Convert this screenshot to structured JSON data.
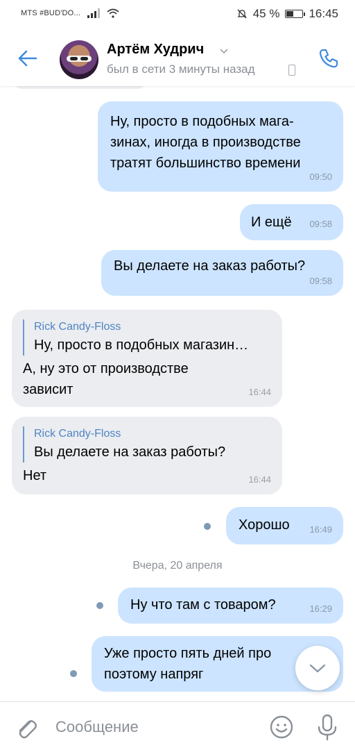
{
  "statusbar": {
    "carrier": "MTS #BUD'DO...",
    "battery": "45 %",
    "battery_level": 0.45,
    "time": "16:45"
  },
  "header": {
    "name": "Артём Худрич",
    "status": "был в сети 3 минуты назад"
  },
  "messages": [
    {
      "dir": "out",
      "lines": [
        "Ну, просто в подобных мага-",
        "зинах, иногда в производстве",
        "тратят большинство времени"
      ],
      "time": "09:50"
    },
    {
      "dir": "out",
      "lines": [
        "И ещё"
      ],
      "time": "09:58"
    },
    {
      "dir": "out",
      "lines": [
        "Вы делаете на заказ работы?"
      ],
      "time": "09:58"
    },
    {
      "dir": "in",
      "reply_author": "Rick Candy-Floss",
      "reply_text": "Ну, просто в подобных магазин…",
      "lines": [
        "А, ну это от производстве",
        "зависит"
      ],
      "time": "16:44"
    },
    {
      "dir": "in",
      "reply_author": "Rick Candy-Floss",
      "reply_text": "Вы делаете на заказ работы?",
      "lines": [
        "Нет"
      ],
      "time": "16:44"
    },
    {
      "dir": "out",
      "lines": [
        "Хорошо"
      ],
      "time": "16:49",
      "unread": true
    },
    {
      "dir": "out",
      "lines": [
        "Ну что там с товаром?"
      ],
      "time": "16:29",
      "unread": true
    },
    {
      "dir": "out",
      "lines": [
        "Уже просто пять дней про",
        "поэтому напряг"
      ],
      "unread": true
    }
  ],
  "date_separator": "Вчера, 20 апреля",
  "input": {
    "placeholder": "Сообщение"
  },
  "icons": {
    "back": "arrow-left-icon",
    "call": "phone-icon",
    "attach": "paperclip-icon",
    "emoji": "smile-icon",
    "mic": "microphone-icon",
    "scroll": "chevron-down-icon"
  },
  "colors": {
    "accent": "#3f8ae0",
    "outgoing_bubble": "#cce4ff",
    "incoming_bubble": "#ebedf0",
    "reply_author": "#4f84c4"
  }
}
